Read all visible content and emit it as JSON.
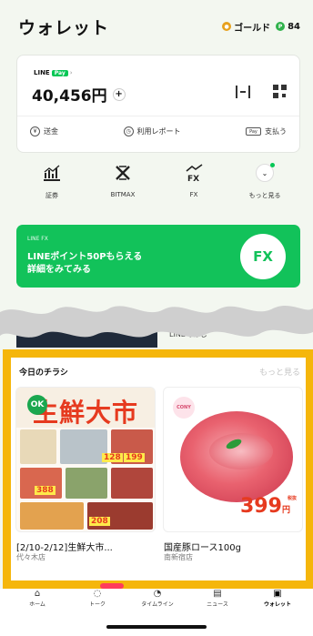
{
  "header": {
    "title": "ウォレット",
    "gold_label": "ゴールド",
    "points": "84"
  },
  "balance": {
    "linepay_label": "LINE",
    "pay_badge": "Pay",
    "amount": "40,456円",
    "add": "+",
    "actions": [
      {
        "icon": "yen-icon",
        "glyph": "¥",
        "label": "送金"
      },
      {
        "icon": "clock-icon",
        "glyph": "◷",
        "label": "利用レポート"
      },
      {
        "icon": "pay-icon",
        "glyph": "Pay",
        "label": "支払う"
      }
    ]
  },
  "services": [
    {
      "icon": "chart-icon",
      "glyph": "📊",
      "label": "証券"
    },
    {
      "icon": "bitmax-icon",
      "glyph": "✕",
      "label": "BITMAX"
    },
    {
      "icon": "fx-icon",
      "glyph": "FX",
      "label": "FX"
    },
    {
      "icon": "chevron-down-icon",
      "glyph": "⌄",
      "label": "もっと見る"
    }
  ],
  "banner": {
    "tag": "LINE FX",
    "line1": "LINEポイント50Pもらえる",
    "line2": "詳細をみてみる",
    "logo": "FX"
  },
  "snippet": {
    "text": "LINEではじ"
  },
  "flyers": {
    "title": "今日のチラシ",
    "more": "もっと見る",
    "items": [
      {
        "name": "[2/10-2/12]生鮮大市...",
        "store": "代々木店",
        "big": "生鮮大市",
        "prices": [
          "388",
          "208",
          "128",
          "199"
        ]
      },
      {
        "name": "国産豚ロース100g",
        "store": "南新宿店",
        "brand": "CONY",
        "price": "399",
        "yen": "円",
        "tax": "税抜"
      }
    ]
  },
  "nav": [
    {
      "icon": "home-icon",
      "glyph": "⌂",
      "label": "ホーム"
    },
    {
      "icon": "chat-icon",
      "glyph": "💬",
      "label": "トーク"
    },
    {
      "icon": "timeline-icon",
      "glyph": "◔",
      "label": "タイムライン"
    },
    {
      "icon": "news-icon",
      "glyph": "▤",
      "label": "ニュース"
    },
    {
      "icon": "wallet-icon",
      "glyph": "▣",
      "label": "ウォレット"
    }
  ],
  "colors": {
    "accent": "#06c755",
    "highlight": "#f5b60b",
    "price": "#e63a1f"
  }
}
